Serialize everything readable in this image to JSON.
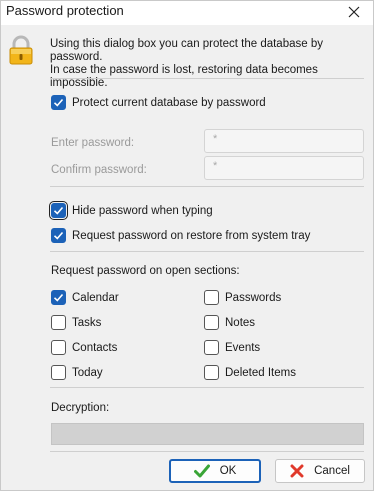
{
  "window": {
    "title": "Password protection",
    "close_icon": "close-icon"
  },
  "info": {
    "icon": "padlock-icon",
    "line1": "Using this dialog box you can protect the database by password.",
    "line2": "In case the password is lost, restoring data becomes impossible."
  },
  "protect": {
    "label": "Protect current database by password",
    "checked": true
  },
  "password": {
    "enter_label": "Enter password:",
    "enter_value": "*",
    "confirm_label": "Confirm password:",
    "confirm_value": "*"
  },
  "options": {
    "hide": {
      "label": "Hide password when typing",
      "checked": true
    },
    "tray": {
      "label": "Request password on restore from system tray",
      "checked": true
    }
  },
  "sections": {
    "label": "Request password on open sections:",
    "items": [
      {
        "label": "Calendar",
        "checked": true
      },
      {
        "label": "Passwords",
        "checked": false
      },
      {
        "label": "Tasks",
        "checked": false
      },
      {
        "label": "Notes",
        "checked": false
      },
      {
        "label": "Contacts",
        "checked": false
      },
      {
        "label": "Events",
        "checked": false
      },
      {
        "label": "Today",
        "checked": false
      },
      {
        "label": "Deleted Items",
        "checked": false
      }
    ]
  },
  "decryption": {
    "label": "Decryption:",
    "progress": 0
  },
  "buttons": {
    "ok": "OK",
    "ok_icon": "checkmark-icon",
    "cancel": "Cancel",
    "cancel_icon": "red-x-icon"
  },
  "colors": {
    "accent": "#1c62b8",
    "ok_icon": "#3aa537",
    "cancel_icon": "#e0392b"
  }
}
